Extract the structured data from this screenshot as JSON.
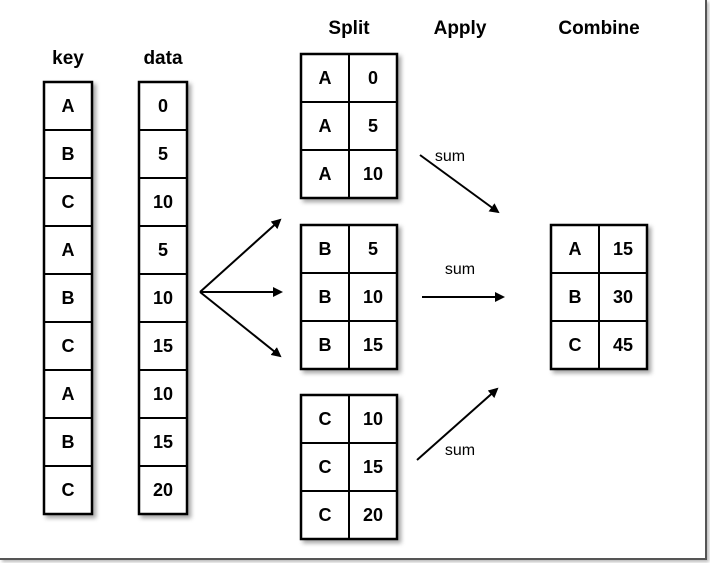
{
  "headers": {
    "key": "key",
    "data": "data",
    "split": "Split",
    "apply": "Apply",
    "combine": "Combine"
  },
  "input": {
    "key": [
      "A",
      "B",
      "C",
      "A",
      "B",
      "C",
      "A",
      "B",
      "C"
    ],
    "data": [
      "0",
      "5",
      "10",
      "5",
      "10",
      "15",
      "10",
      "15",
      "20"
    ]
  },
  "split_groups": [
    {
      "rows": [
        [
          "A",
          "0"
        ],
        [
          "A",
          "5"
        ],
        [
          "A",
          "10"
        ]
      ]
    },
    {
      "rows": [
        [
          "B",
          "5"
        ],
        [
          "B",
          "10"
        ],
        [
          "B",
          "15"
        ]
      ]
    },
    {
      "rows": [
        [
          "C",
          "10"
        ],
        [
          "C",
          "15"
        ],
        [
          "C",
          "20"
        ]
      ]
    }
  ],
  "apply_label": "sum",
  "combined": [
    [
      "A",
      "15"
    ],
    [
      "B",
      "30"
    ],
    [
      "C",
      "45"
    ]
  ]
}
